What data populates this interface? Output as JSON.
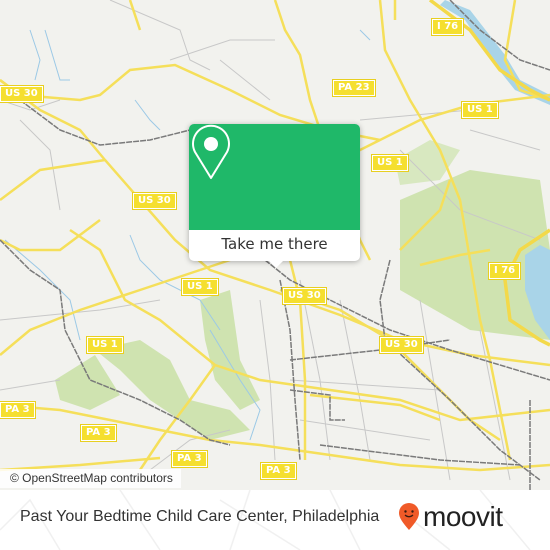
{
  "map": {
    "attribution": "© OpenStreetMap contributors",
    "colors": {
      "background": "#f2f2ee",
      "road": "#f5df5a",
      "park": "#cfe3b0",
      "water": "#a9d4e8",
      "rail": "#7a7a7a"
    },
    "shields": [
      {
        "label": "US 30",
        "type": "us-route"
      },
      {
        "label": "US 30",
        "type": "us-route"
      },
      {
        "label": "PA 23",
        "type": "state-route"
      },
      {
        "label": "I 76",
        "type": "interstate"
      },
      {
        "label": "US 1",
        "type": "us-route"
      },
      {
        "label": "US 1",
        "type": "us-route"
      },
      {
        "label": "US 1",
        "type": "us-route"
      },
      {
        "label": "US 1",
        "type": "us-route"
      },
      {
        "label": "US 30",
        "type": "us-route"
      },
      {
        "label": "US 30",
        "type": "us-route"
      },
      {
        "label": "I 76",
        "type": "interstate"
      },
      {
        "label": "PA 3",
        "type": "state-route"
      },
      {
        "label": "PA 3",
        "type": "state-route"
      },
      {
        "label": "PA 3",
        "type": "state-route"
      },
      {
        "label": "PA 3",
        "type": "state-route"
      }
    ]
  },
  "popup": {
    "icon": "map-pin-icon",
    "button_label": "Take me there",
    "accent": "#1fb869"
  },
  "footer": {
    "title": "Past Your Bedtime Child Care Center, Philadelphia",
    "logo_text": "moovit",
    "logo_color": "#f05a28"
  }
}
